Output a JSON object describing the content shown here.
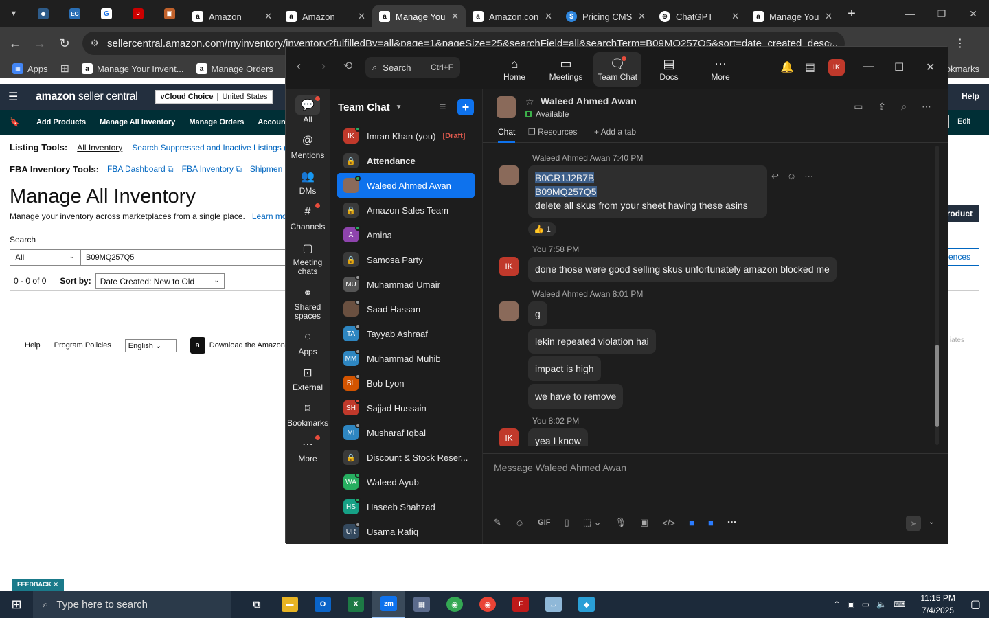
{
  "browser": {
    "tabs": [
      {
        "title": "Amazon",
        "icon": "amazon-icon",
        "active": false
      },
      {
        "title": "Amazon",
        "icon": "amazon-icon",
        "active": false
      },
      {
        "title": "Manage You",
        "icon": "amazon-icon",
        "active": true
      },
      {
        "title": "Amazon.con",
        "icon": "amazon-icon",
        "active": false
      },
      {
        "title": "Pricing CMS",
        "icon": "dollar-icon",
        "active": false
      },
      {
        "title": "ChatGPT",
        "icon": "chatgpt-icon",
        "active": false
      },
      {
        "title": "Manage You",
        "icon": "amazon-icon",
        "active": false
      }
    ],
    "url": "sellercentral.amazon.com/myinventory/inventory?fulfilledBy=all&page=1&pageSize=25&searchField=all&searchTerm=B09MQ257Q5&sort=date_created_desc...",
    "bookmarks": [
      {
        "label": "Apps"
      },
      {
        "label": "Manage Your Invent..."
      },
      {
        "label": "Manage Orders"
      }
    ],
    "bookmarks_right": "okmarks"
  },
  "seller": {
    "logo_bold": "amazon",
    "logo_rest": " seller central",
    "store_name": "vCloud Choice",
    "store_region": "United States",
    "help": "Help",
    "edit": "Edit",
    "nav": [
      "Add Products",
      "Manage All Inventory",
      "Manage Orders",
      "Account Health"
    ],
    "listing_tools_label": "Listing Tools:",
    "listing_links": [
      "All Inventory",
      "Search Suppressed and Inactive Listings (11"
    ],
    "fba_label": "FBA Inventory Tools:",
    "fba_links": [
      "FBA Dashboard",
      "FBA Inventory",
      "Shipmen"
    ],
    "title": "Manage All Inventory",
    "subtitle": "Manage your inventory across marketplaces from a single place.",
    "learn_more": "Learn more",
    "search_label": "Search",
    "filter_value": "All",
    "search_value": "B09MQ257Q5",
    "results": "0 - 0 of 0",
    "sort_label": "Sort by:",
    "sort_value": "Date Created: New to Old",
    "add_product": "roduct",
    "preferences": "rences",
    "affiliates": "iates",
    "footer": [
      "Help",
      "Program Policies"
    ],
    "language": "English",
    "download": "Download the Amazon S",
    "feedback": "FEEDBACK ✕"
  },
  "zoom": {
    "search": "Search",
    "search_kbd": "Ctrl+F",
    "top": [
      {
        "label": "Home",
        "icon": "home-icon"
      },
      {
        "label": "Meetings",
        "icon": "video-icon"
      },
      {
        "label": "Team Chat",
        "icon": "chat-icon"
      },
      {
        "label": "Docs",
        "icon": "docs-icon"
      },
      {
        "label": "More",
        "icon": "more-icon"
      }
    ],
    "user_initials": "IK",
    "rail": [
      {
        "label": "All",
        "icon": "chat-bubble-icon"
      },
      {
        "label": "Mentions",
        "icon": "at-icon"
      },
      {
        "label": "DMs",
        "icon": "people-icon"
      },
      {
        "label": "Channels",
        "icon": "hash-icon"
      },
      {
        "label": "Meeting chats",
        "icon": "calendar-icon"
      },
      {
        "label": "Shared spaces",
        "icon": "shared-icon"
      },
      {
        "label": "Apps",
        "icon": "apps-icon"
      },
      {
        "label": "External",
        "icon": "external-icon"
      },
      {
        "label": "Bookmarks",
        "icon": "bookmark-icon"
      },
      {
        "label": "More",
        "icon": "more-icon"
      }
    ],
    "list_title": "Team Chat",
    "chats": [
      {
        "name": "Imran Khan (you)",
        "initials": "IK",
        "color": "#c0392b",
        "draft": "[Draft]"
      },
      {
        "name": "Attendance",
        "lock": true,
        "bold": true
      },
      {
        "name": "Waleed Ahmed Awan",
        "initials": "",
        "color": "#8a6a5a",
        "selected": true
      },
      {
        "name": "Amazon Sales Team",
        "lock": true
      },
      {
        "name": "Amina",
        "initials": "A",
        "color": "#8e44ad"
      },
      {
        "name": "Samosa Party",
        "lock": true
      },
      {
        "name": "Muhammad Umair",
        "initials": "MU",
        "color": "#555"
      },
      {
        "name": "Saad Hassan",
        "initials": "",
        "color": "#6a5040"
      },
      {
        "name": "Tayyab Ashraaf",
        "initials": "TA",
        "color": "#2e86c1"
      },
      {
        "name": "Muhammad Muhib",
        "initials": "MM",
        "color": "#2e86c1"
      },
      {
        "name": "Bob Lyon",
        "initials": "BL",
        "color": "#d35400"
      },
      {
        "name": "Sajjad Hussain",
        "initials": "SH",
        "color": "#c0392b"
      },
      {
        "name": "Musharaf Iqbal",
        "initials": "MI",
        "color": "#2e86c1"
      },
      {
        "name": "Discount & Stock Reser...",
        "lock": true
      },
      {
        "name": "Waleed Ayub",
        "initials": "WA",
        "color": "#27ae60"
      },
      {
        "name": "Haseeb Shahzad",
        "initials": "HS",
        "color": "#16a085"
      },
      {
        "name": "Usama Rafiq",
        "initials": "UR",
        "color": "#34495e"
      }
    ],
    "contact_name": "Waleed Ahmed Awan",
    "contact_status": "Available",
    "tabs": [
      "Chat",
      "Resources",
      "+ Add a tab"
    ],
    "msg1_meta": "Waleed Ahmed Awan 7:40 PM",
    "msg1_line1": "B0CR1J2B7B",
    "msg1_line2": "B09MQ257Q5",
    "msg1_line3": "delete all skus from your sheet having these asins",
    "msg1_reaction": "👍 1",
    "msg2_meta": "You 7:58 PM",
    "msg2_text": "done those were good selling skus  unfortunately amazon blocked me",
    "msg3_meta": "Waleed Ahmed Awan 8:01 PM",
    "msg3_texts": [
      "g",
      "lekin repeated violation hai",
      "impact is high",
      "we have to remove"
    ],
    "msg4_meta": "You 8:02 PM",
    "msg4_text": "yea I know",
    "compose_placeholder": "Message Waleed Ahmed Awan"
  },
  "taskbar": {
    "search": "Type here to search",
    "time": "11:15 PM",
    "date": "7/4/2025"
  }
}
